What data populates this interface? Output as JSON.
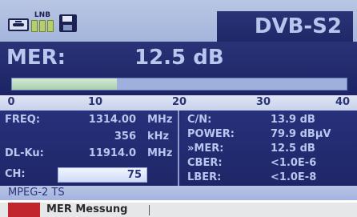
{
  "status_bar": {
    "lnb_label": "LNB",
    "icons": [
      "antenna-icon",
      "lnb-power-icon",
      "save-disk-icon"
    ],
    "mode": "DVB-S2"
  },
  "mer": {
    "label": "MER:",
    "value": "12.5 dB",
    "bar_level_fraction": 0.3125
  },
  "scale_ticks": [
    "0",
    "10",
    "20",
    "30",
    "40"
  ],
  "left_panel": {
    "freq_label": "FREQ:",
    "freq_value": "1314.00",
    "freq_unit": "MHz",
    "offset_value": "356",
    "offset_unit": "kHz",
    "dlku_label": "DL-Ku:",
    "dlku_value": "11914.0",
    "dlku_unit": "MHz",
    "ch_label": "CH:",
    "ch_value": "75"
  },
  "right_panel": {
    "rows": [
      {
        "label": "C/N:",
        "value": "13.9 dB"
      },
      {
        "label": "POWER:",
        "value": "79.9 dBµV"
      },
      {
        "label": "»MER:",
        "value": "12.5 dB"
      },
      {
        "label": "CBER:",
        "value": "<1.0E-6"
      },
      {
        "label": "LBER:",
        "value": "<1.0E-8"
      }
    ]
  },
  "stream": {
    "type": "MPEG-2 TS"
  },
  "caption": {
    "text": "MER Messung"
  },
  "colors": {
    "panel_bg": "#202a70",
    "frame_bg": "#9fb2d8",
    "text": "#b9c6ee",
    "bar_fill": "#a9d0ad",
    "caption_accent": "#c0262c"
  }
}
